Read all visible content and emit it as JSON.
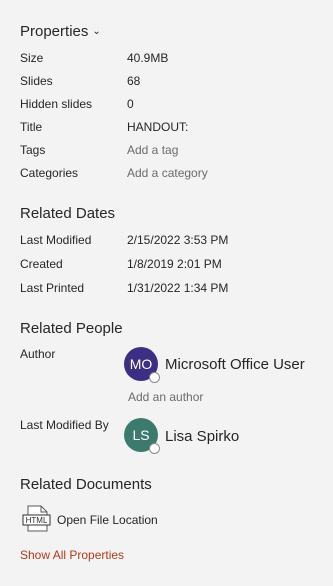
{
  "properties": {
    "heading": "Properties",
    "rows": [
      {
        "label": "Size",
        "value": "40.9MB"
      },
      {
        "label": "Slides",
        "value": "68"
      },
      {
        "label": "Hidden slides",
        "value": "0"
      },
      {
        "label": "Title",
        "value": "HANDOUT:"
      },
      {
        "label": "Tags",
        "placeholder": "Add a tag"
      },
      {
        "label": "Categories",
        "placeholder": "Add a category"
      }
    ]
  },
  "related_dates": {
    "heading": "Related Dates",
    "rows": [
      {
        "label": "Last Modified",
        "value": "2/15/2022 3:53 PM"
      },
      {
        "label": "Created",
        "value": "1/8/2019 2:01 PM"
      },
      {
        "label": "Last Printed",
        "value": "1/31/2022 1:34 PM"
      }
    ]
  },
  "related_people": {
    "heading": "Related People",
    "author_label": "Author",
    "author": {
      "initials": "MO",
      "name": "Microsoft Office User",
      "color": "#3b2e83"
    },
    "add_author": "Add an author",
    "last_modified_by_label": "Last Modified By",
    "last_modified_by": {
      "initials": "LS",
      "name": "Lisa Spirko",
      "color": "#3c7a6e"
    }
  },
  "related_documents": {
    "heading": "Related Documents",
    "open_file_location": "Open File Location",
    "icon": "html-file-icon",
    "icon_text": "HTML"
  },
  "show_all_properties": "Show All Properties"
}
